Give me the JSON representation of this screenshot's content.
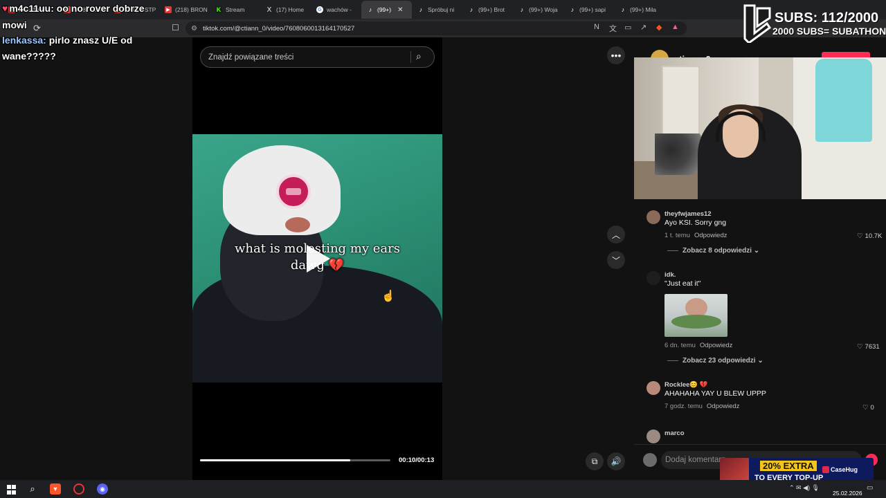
{
  "browser": {
    "tabs": [
      {
        "label": "m4c11uu",
        "icon": "heart-icon"
      },
      {
        "label": "(218) Ushe",
        "icon": "youtube-icon"
      },
      {
        "label": "(218) OSTP",
        "icon": "youtube-icon"
      },
      {
        "label": "(218) BRON",
        "icon": "youtube-icon"
      },
      {
        "label": "Stream",
        "icon": "kick-icon"
      },
      {
        "label": "(17) Home",
        "icon": "x-icon"
      },
      {
        "label": "wachów -",
        "icon": "google-icon"
      },
      {
        "label": "(99+)",
        "icon": "tiktok-icon",
        "active": true
      },
      {
        "label": "Spróbuj ni",
        "icon": "tiktok-icon"
      },
      {
        "label": "(99+) Brot",
        "icon": "tiktok-icon"
      },
      {
        "label": "(99+) Woja",
        "icon": "tiktok-icon"
      },
      {
        "label": "(99+) sapi",
        "icon": "tiktok-icon"
      },
      {
        "label": "(99+) Mila",
        "icon": "tiktok-icon"
      }
    ],
    "url": "tiktok.com/@ctiann_0/video/7608060013164170527"
  },
  "overlay": {
    "chat": [
      {
        "user": "m4c11uu:",
        "message": "oo no rover dobrze",
        "continued": "mowi"
      },
      {
        "user": "lenkassa:",
        "message": "pirlo znasz U/E od",
        "continued": "wane?????"
      }
    ],
    "subs_count": "SUBS: 112/2000",
    "subs_goal": "2000 SUBS= SUBATHON"
  },
  "tiktok": {
    "search_placeholder": "Znajdź powiązane treści",
    "video": {
      "caption_line1": "what is molesting my ears",
      "caption_line2": "dawg 💔",
      "current_time": "00:10",
      "duration": "00:13",
      "time_label": "00:10/00:13",
      "progress_fraction": 0.79
    },
    "author": {
      "name": "ctiann_0"
    },
    "comments": [
      {
        "user": "theyfwjames12",
        "text": "Ayo KSI. Sorry gng",
        "time": "1 t. temu",
        "reply": "Odpowiedz",
        "likes": "10.7K",
        "replies": "Zobacz 8 odpowiedzi",
        "avatar_color": "#8a6a5a"
      },
      {
        "user": "idk.",
        "text": "\"Just eat it\"",
        "time": "6 dn. temu",
        "reply": "Odpowiedz",
        "likes": "7631",
        "replies": "Zobacz 23 odpowiedzi",
        "avatar_color": "#1e1e1e"
      },
      {
        "user": "Rocklee😊 💔",
        "text": "AHAHAHA YAY U BLEW UPPP",
        "time": "7 godz. temu",
        "reply": "Odpowiedz",
        "likes": "0",
        "avatar_color": "#b88a7a"
      },
      {
        "user": "marco",
        "avatar_color": "#9a8a80"
      }
    ],
    "add_comment_placeholder": "Dodaj komentarz..."
  },
  "ad": {
    "line1": "20% EXTRA",
    "line2": "TO EVERY TOP-UP",
    "brand": "CaseHug"
  },
  "taskbar": {
    "date": "25.02.2026"
  }
}
